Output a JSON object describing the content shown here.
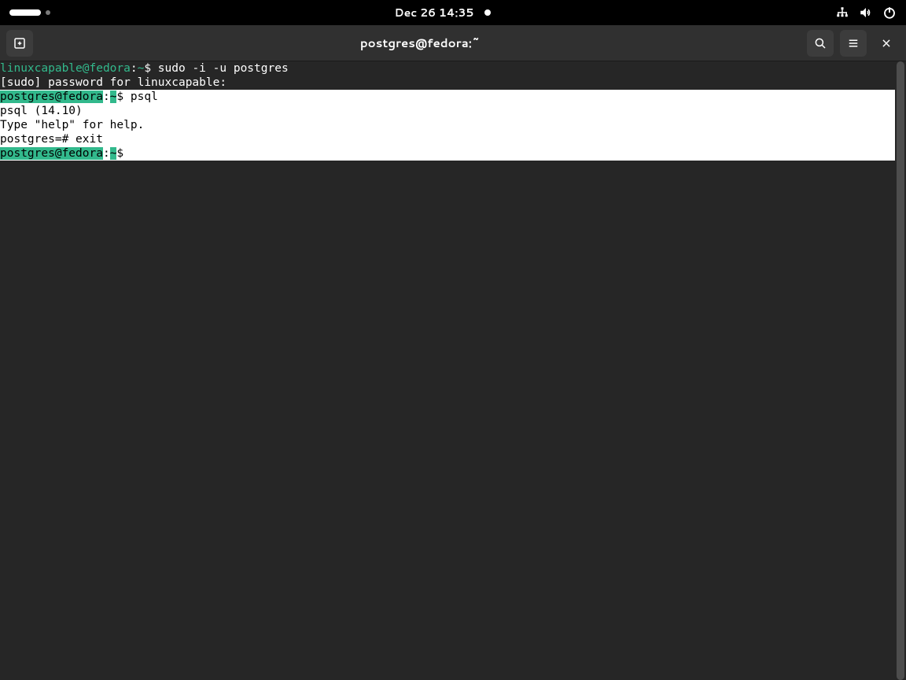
{
  "topbar": {
    "datetime": "Dec 26  14:35"
  },
  "window": {
    "title": "postgres@fedora:~"
  },
  "terminal": {
    "line1_user": "linuxcapable@fedora",
    "line1_sep": ":",
    "line1_tilde": "~",
    "line1_dollar": "$",
    "line1_cmd": " sudo -i -u postgres",
    "line2": "[sudo] password for linuxcapable: ",
    "line3_user": "postgres@fedora",
    "line3_sep": ":",
    "line3_tilde": "~",
    "line3_dollar": "$",
    "line3_cmd": " psql",
    "line4": "psql (14.10)",
    "line5": "Type \"help\" for help.",
    "line6": "",
    "line7": "postgres=# exit",
    "line8_user": "postgres@fedora",
    "line8_sep": ":",
    "line8_tilde": "~",
    "line8_dollar": "$",
    "line8_rest": " "
  }
}
